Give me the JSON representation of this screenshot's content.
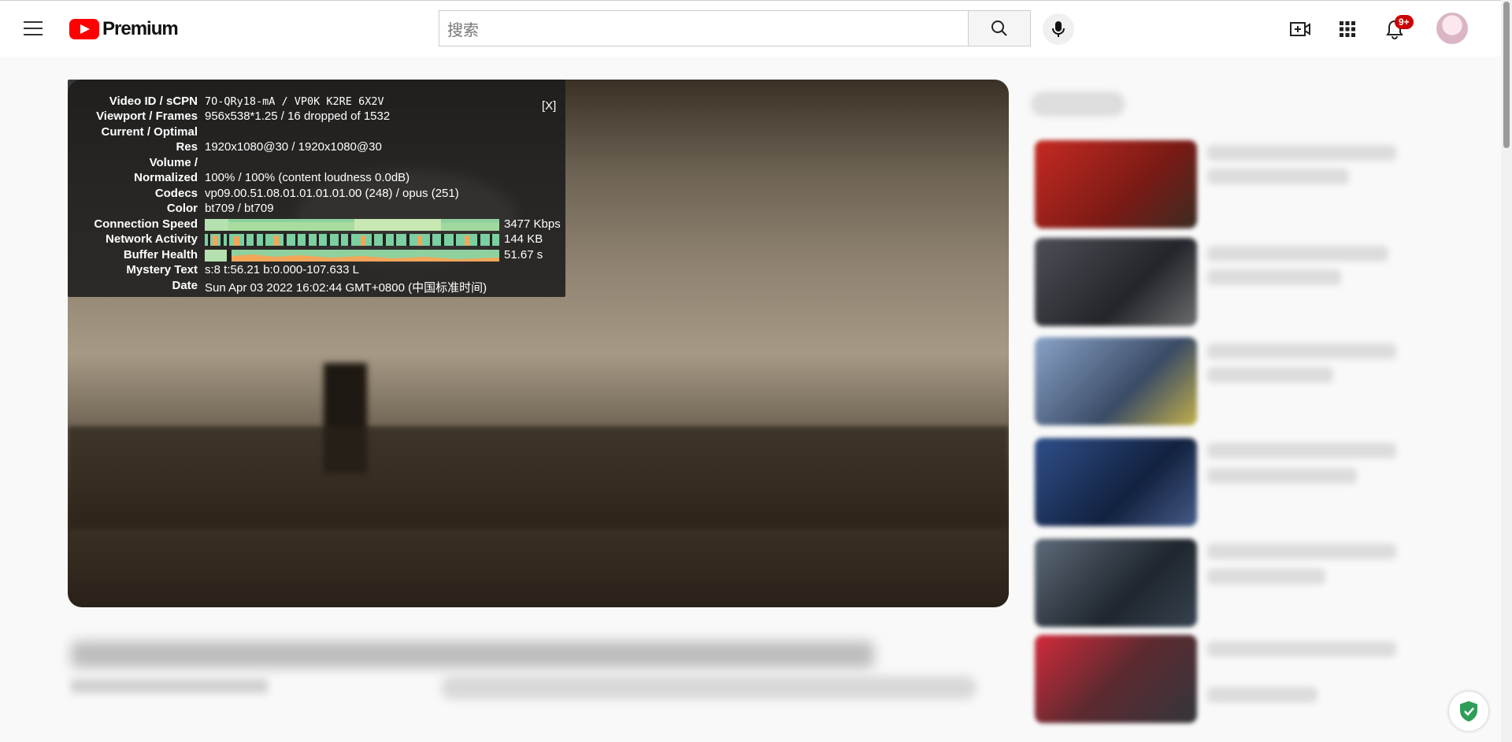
{
  "header": {
    "brand": "Premium",
    "search_placeholder": "搜索",
    "notification_count": "9+"
  },
  "stats_for_nerds": {
    "close_label": "[X]",
    "rows": [
      {
        "label": "Video ID / sCPN",
        "value": "7O-QRy18-mA / VP0K K2RE 6X2V"
      },
      {
        "label": "Viewport / Frames",
        "value": "956x538*1.25 / 16 dropped of 1532"
      },
      {
        "label": "Current / Optimal",
        "value": ""
      },
      {
        "label": "Res",
        "value": "1920x1080@30 / 1920x1080@30"
      },
      {
        "label": "Volume /",
        "value": ""
      },
      {
        "label": "Normalized",
        "value": "100% / 100% (content loudness 0.0dB)"
      },
      {
        "label": "Codecs",
        "value": "vp09.00.51.08.01.01.01.01.00 (248) / opus (251)"
      },
      {
        "label": "Color",
        "value": "bt709 / bt709"
      },
      {
        "label": "Connection Speed",
        "value": "3477 Kbps"
      },
      {
        "label": "Network Activity",
        "value": "144 KB"
      },
      {
        "label": "Buffer Health",
        "value": "51.67 s"
      },
      {
        "label": "Mystery Text",
        "value": "s:8 t:56.21 b:0.000-107.633 L"
      },
      {
        "label": "Date",
        "value": "Sun Apr 03 2022 16:02:44 GMT+0800 (中国标准时间)"
      }
    ]
  },
  "icons": {
    "menu": "hamburger-menu-icon",
    "search": "search-icon",
    "mic": "microphone-icon",
    "create": "create-video-icon",
    "apps": "apps-grid-icon",
    "notifications": "bell-icon",
    "shield": "shield-check-icon"
  },
  "colors": {
    "brand_red": "#ff0000",
    "badge_red": "#cc0000",
    "graph_green": "#8fd19e",
    "graph_orange": "#f2a65a",
    "shield_green": "#2e9e57"
  }
}
